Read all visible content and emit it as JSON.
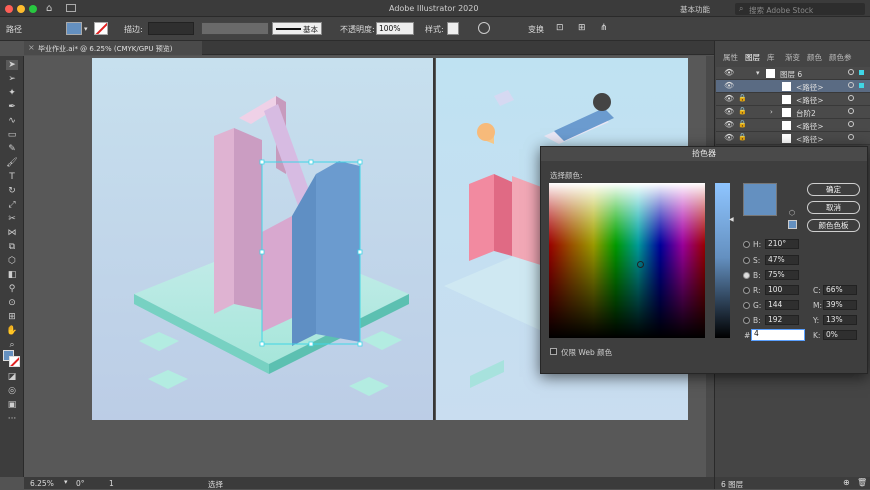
{
  "window": {
    "title": "Adobe Illustrator 2020",
    "workspace": "基本功能",
    "search_placeholder": "搜索 Adobe Stock"
  },
  "control": {
    "selection_type": "路径",
    "stroke_label": "描边:",
    "brush": "基本",
    "opacity_label": "不透明度:",
    "opacity_value": "100%",
    "style_label": "样式:",
    "transform": "变换"
  },
  "document": {
    "tab_title": "毕业作业.ai* @ 6.25% (CMYK/GPU 预览)"
  },
  "status": {
    "zoom": "6.25%",
    "rotation": "0°",
    "artboard": "1",
    "mode": "选择"
  },
  "panel": {
    "tabs": [
      "属性",
      "图层",
      "库",
      "渐变",
      "颜色",
      "颜色参"
    ],
    "footer": "6 图层",
    "layers": [
      {
        "name": "图层 6"
      },
      {
        "name": "<路径>"
      },
      {
        "name": "<路径>"
      },
      {
        "name": "台阶2"
      },
      {
        "name": "<路径>"
      },
      {
        "name": "<路径>"
      }
    ]
  },
  "picker": {
    "title": "拾色器",
    "select_label": "选择颜色:",
    "ok": "确定",
    "cancel": "取消",
    "swatches": "颜色色板",
    "web_only": "仅限 Web 颜色",
    "h_label": "H:",
    "h": "210°",
    "s_label": "S:",
    "s": "47%",
    "b_label": "B:",
    "b": "75%",
    "r_label": "R:",
    "r": "100",
    "g_label": "G:",
    "g": "144",
    "bl_label": "B:",
    "bl": "192",
    "c_label": "C:",
    "c": "66%",
    "m_label": "M:",
    "m": "39%",
    "y_label": "Y:",
    "y": "13%",
    "k_label": "K:",
    "k": "0%",
    "hex_label": "#",
    "hex": "4",
    "color": "#6490c0"
  }
}
